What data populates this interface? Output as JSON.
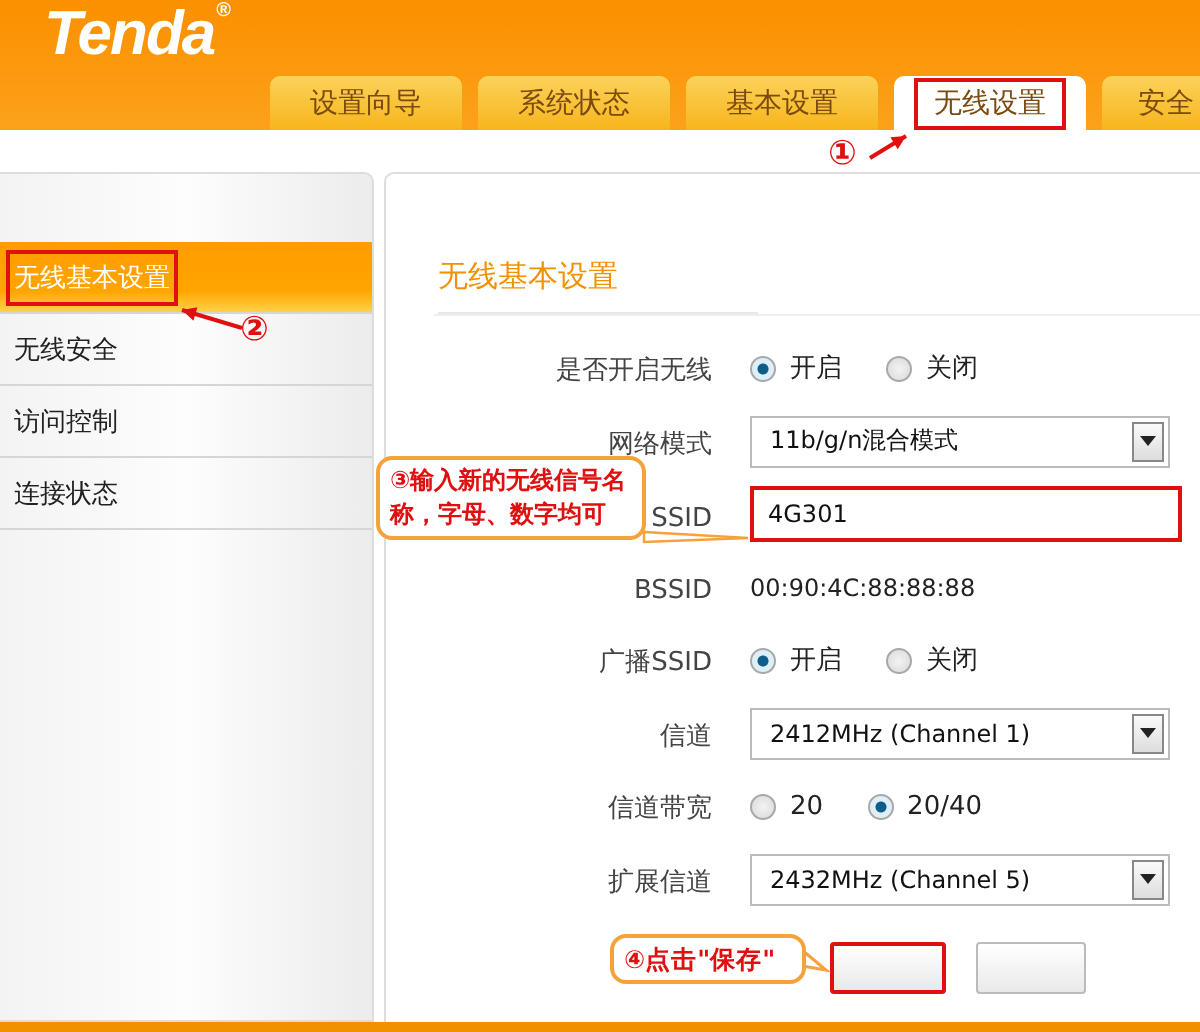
{
  "logo": {
    "text": "Tenda",
    "mark": "®"
  },
  "tabs": [
    {
      "label": "设置向导",
      "selected": false
    },
    {
      "label": "系统状态",
      "selected": false
    },
    {
      "label": "基本设置",
      "selected": false
    },
    {
      "label": "无线设置",
      "selected": true,
      "highlighted": true,
      "note": "①"
    },
    {
      "label": "安全",
      "selected": false
    }
  ],
  "sidebar": {
    "items": [
      {
        "label": "无线基本设置",
        "selected": true,
        "highlighted": true,
        "note": "②"
      },
      {
        "label": "无线安全",
        "selected": false
      },
      {
        "label": "访问控制",
        "selected": false
      },
      {
        "label": "连接状态",
        "selected": false
      }
    ]
  },
  "panel": {
    "title": "无线基本设置",
    "fields": [
      {
        "kind": "radio",
        "label": "是否开启无线",
        "options": [
          {
            "label": "开启",
            "selected": true
          },
          {
            "label": "关闭",
            "selected": false
          }
        ]
      },
      {
        "kind": "select",
        "label": "网络模式",
        "value": "11b/g/n混合模式"
      },
      {
        "kind": "input",
        "label": "SSID",
        "value": "4G301",
        "highlighted": true,
        "note": "③输入新的无线信号名称，字母、数字均可"
      },
      {
        "kind": "text",
        "label": "BSSID",
        "value": "00:90:4C:88:88:88"
      },
      {
        "kind": "radio",
        "label": "广播SSID",
        "options": [
          {
            "label": "开启",
            "selected": true
          },
          {
            "label": "关闭",
            "selected": false
          }
        ]
      },
      {
        "kind": "select",
        "label": "信道",
        "value": "2412MHz (Channel 1)"
      },
      {
        "kind": "radio",
        "label": "信道带宽",
        "options": [
          {
            "label": "20",
            "selected": false
          },
          {
            "label": "20/40",
            "selected": true
          }
        ]
      },
      {
        "kind": "select",
        "label": "扩展信道",
        "value": "2432MHz (Channel 5)"
      }
    ],
    "buttons": [
      {
        "highlighted": true,
        "note": "④点击\"保存\""
      },
      {
        "highlighted": false
      }
    ]
  }
}
